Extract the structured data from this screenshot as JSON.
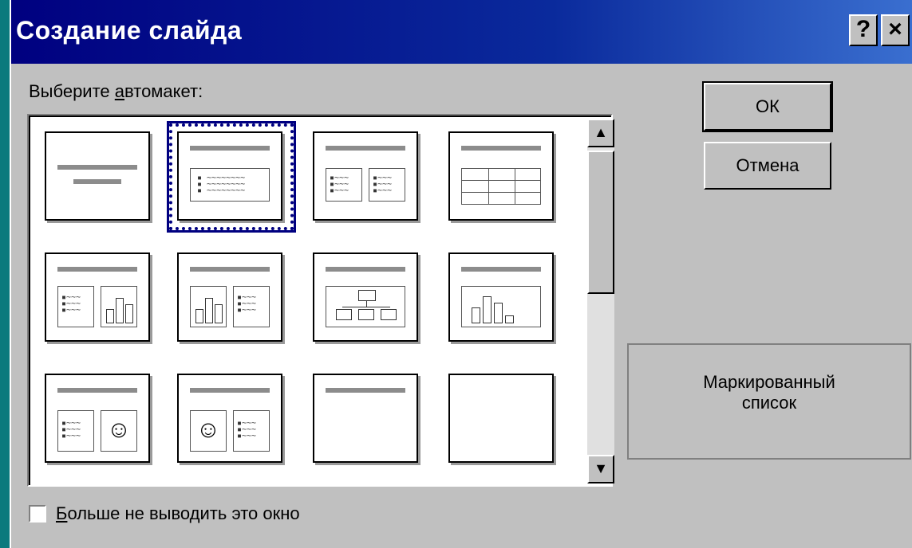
{
  "window": {
    "title": "Создание слайда",
    "help_label": "?",
    "close_label": "×"
  },
  "layout_picker": {
    "label_before": "Выберите ",
    "label_underlined": "а",
    "label_after": "втомакет:",
    "selected_index": 1,
    "selected_name": "Маркированный список",
    "layouts": [
      {
        "id": "title-slide",
        "icon": "title-slide-layout-icon"
      },
      {
        "id": "bulleted-list",
        "icon": "bulleted-list-layout-icon"
      },
      {
        "id": "two-column-text",
        "icon": "two-column-text-layout-icon"
      },
      {
        "id": "table",
        "icon": "table-layout-icon"
      },
      {
        "id": "text-and-chart",
        "icon": "text-and-chart-layout-icon"
      },
      {
        "id": "chart-and-text",
        "icon": "chart-and-text-layout-icon"
      },
      {
        "id": "org-chart",
        "icon": "org-chart-layout-icon"
      },
      {
        "id": "chart",
        "icon": "chart-layout-icon"
      },
      {
        "id": "text-and-clipart",
        "icon": "text-and-clipart-layout-icon"
      },
      {
        "id": "clipart-and-text",
        "icon": "clipart-and-text-layout-icon"
      },
      {
        "id": "title-only",
        "icon": "title-only-layout-icon"
      },
      {
        "id": "blank",
        "icon": "blank-layout-icon"
      }
    ]
  },
  "buttons": {
    "ok_label": "ОК",
    "cancel_label": "Отмена"
  },
  "preview": {
    "line1": "Маркированный",
    "line2": "список"
  },
  "dont_show": {
    "underlined": "Б",
    "rest": "ольше не выводить это окно",
    "checked": false
  },
  "colors": {
    "titlebar": "#000080",
    "dialog_bg": "#c0c0c0",
    "desktop": "#0b7a7d",
    "selection": "#000080"
  }
}
